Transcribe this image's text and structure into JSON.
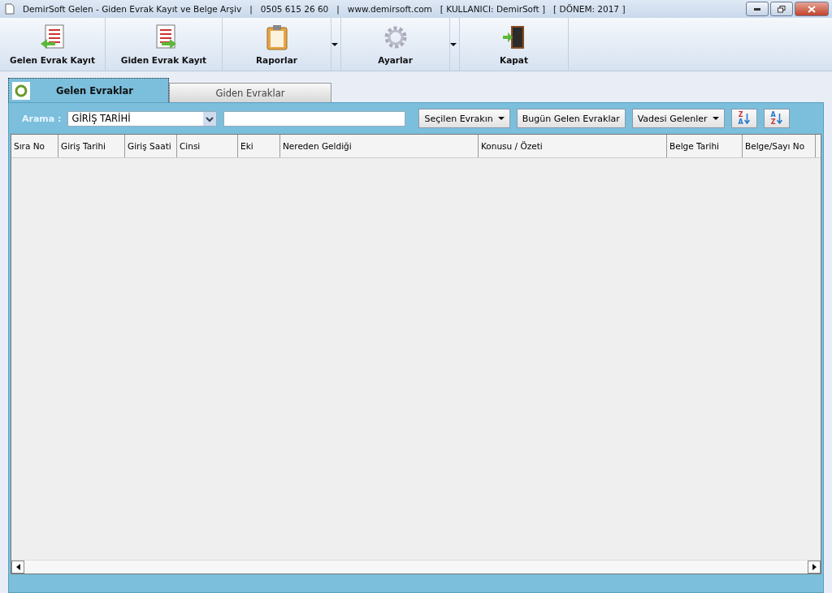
{
  "window": {
    "title_segments": [
      "DemirSoft Gelen - Giden Evrak Kayıt ve Belge Arşiv",
      "|",
      "0505 615 26 60",
      "|",
      "www.demirsoft.com",
      "[ KULLANICI: DemirSoft ]",
      "[ DÖNEM: 2017 ]"
    ]
  },
  "toolbar": [
    {
      "label": "Gelen Evrak Kayıt",
      "kind": "incoming",
      "has_dropdown": false
    },
    {
      "label": "Giden Evrak Kayıt",
      "kind": "outgoing",
      "has_dropdown": false
    },
    {
      "label": "Raporlar",
      "kind": "report",
      "has_dropdown": true
    },
    {
      "label": "Ayarlar",
      "kind": "settings",
      "has_dropdown": true
    },
    {
      "label": "Kapat",
      "kind": "exit",
      "has_dropdown": false
    }
  ],
  "tabs": [
    {
      "label": "Gelen Evraklar",
      "selected": true
    },
    {
      "label": "Giden Evraklar",
      "selected": false
    }
  ],
  "search": {
    "label": "Arama :",
    "field": "GİRİŞ TARİHİ"
  },
  "actions": [
    {
      "label": "Seçilen Evrakın",
      "has_dropdown": true
    },
    {
      "label": "Bugün Gelen Evraklar",
      "has_dropdown": false
    },
    {
      "label": "Vadesi Gelenler",
      "has_dropdown": true
    }
  ],
  "sort_buttons": [
    {
      "top": "Z",
      "bottom": "A"
    },
    {
      "top": "A",
      "bottom": "Z"
    }
  ],
  "table": {
    "columns": [
      "Sıra No",
      "Giriş Tarihi",
      "Giriş Saati",
      "Cinsi",
      "Eki",
      "Nereden Geldiği",
      "Konusu / Özeti",
      "Belge Tarihi",
      "Belge/Sayı No"
    ]
  }
}
